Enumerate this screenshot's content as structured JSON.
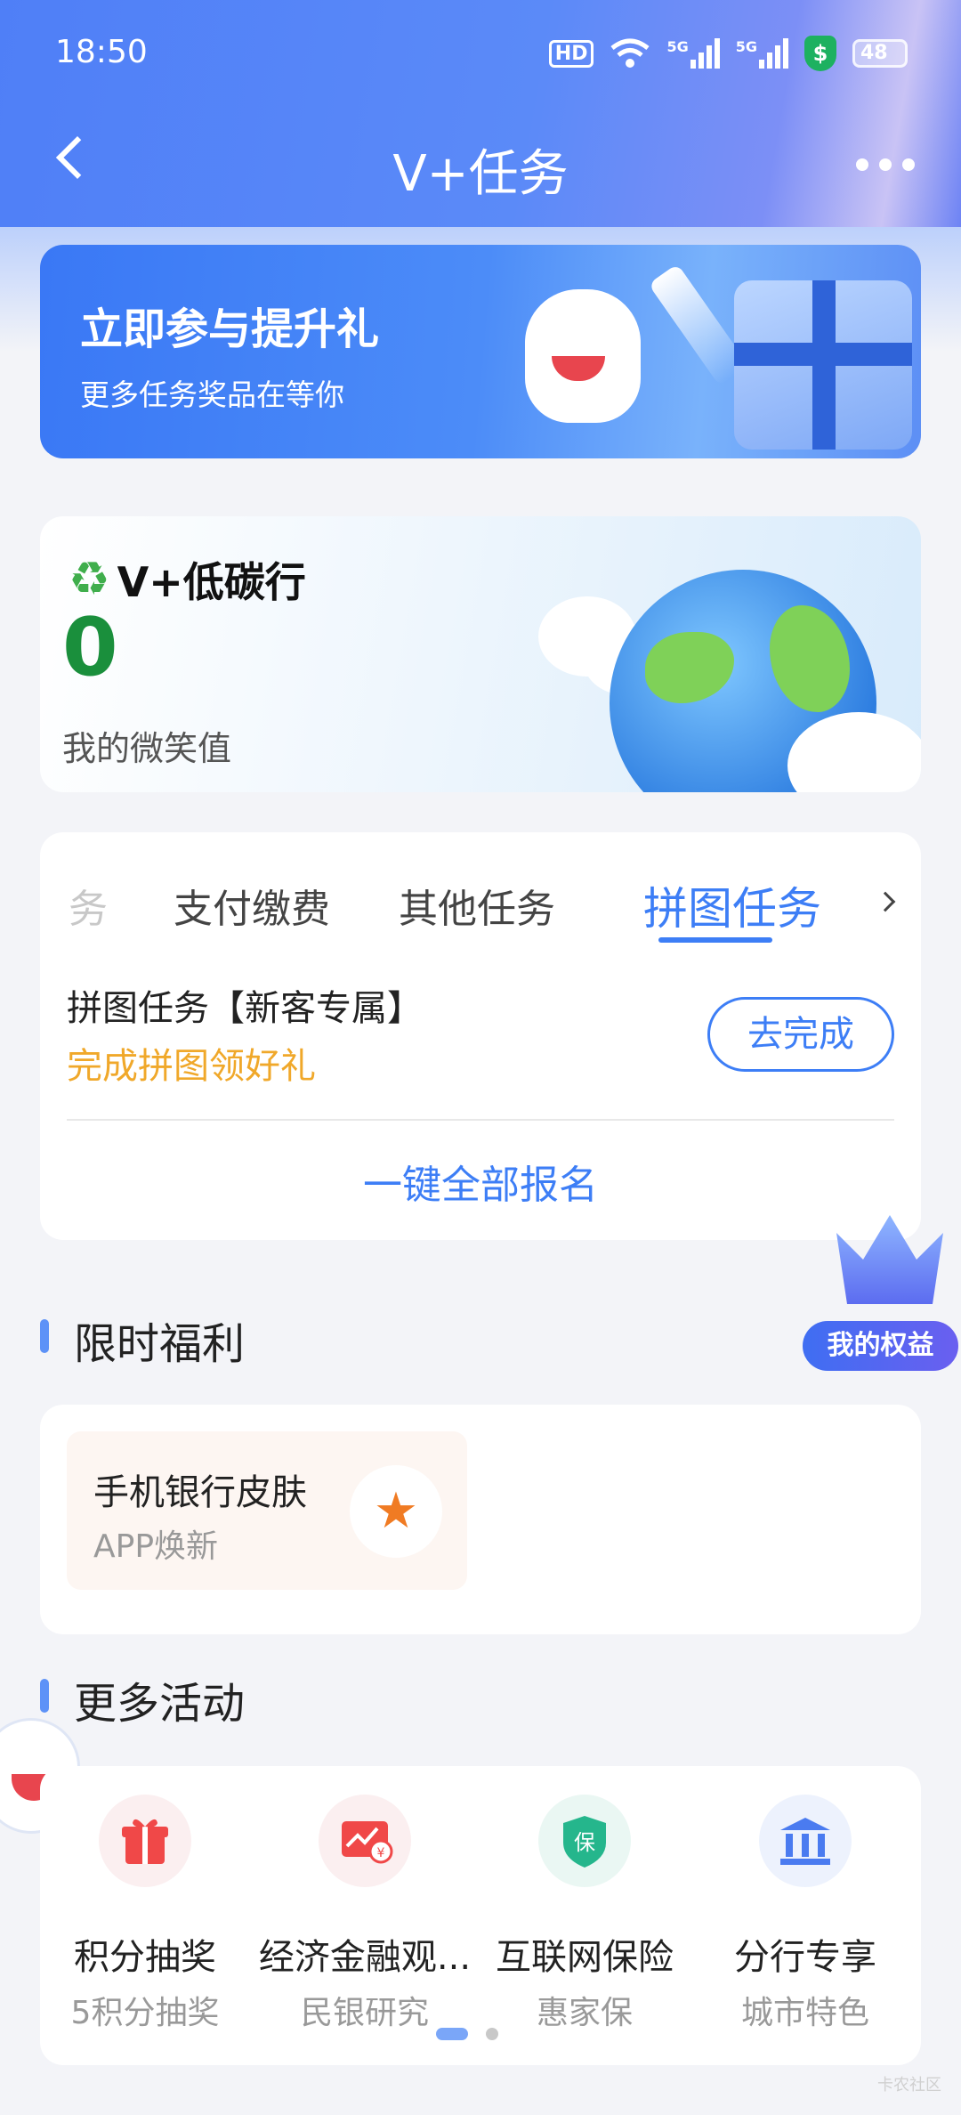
{
  "status_bar": {
    "time": "18:50",
    "hd": "HD",
    "net1": "5G",
    "net2": "5G",
    "security": "$",
    "battery": "48"
  },
  "header": {
    "title": "V+任务"
  },
  "banner": {
    "title": "立即参与提升礼",
    "subtitle": "更多任务奖品在等你"
  },
  "carbon": {
    "name": "V+低碳行",
    "value": "0",
    "label": "我的微笑值"
  },
  "task_card": {
    "tabs": [
      {
        "label": "务",
        "state": "faded"
      },
      {
        "label": "支付缴费",
        "state": "normal"
      },
      {
        "label": "其他任务",
        "state": "normal"
      },
      {
        "label": "拼图任务",
        "state": "active"
      }
    ],
    "task_name": "拼图任务【新客专属】",
    "task_desc": "完成拼图领好礼",
    "go_button": "去完成",
    "enroll_all": "一键全部报名"
  },
  "floating": {
    "rights_label": "我的权益"
  },
  "welfare": {
    "title": "限时福利",
    "item": {
      "title": "手机银行皮肤",
      "subtitle": "APP焕新",
      "icon": "magic-wand-icon"
    }
  },
  "activities": {
    "title": "更多活动",
    "items": [
      {
        "title": "积分抽奖",
        "subtitle": "5积分抽奖",
        "icon": "gift-icon",
        "color": "#f04848"
      },
      {
        "title": "经济金融观...",
        "subtitle": "民银研究",
        "icon": "chart-yuan-icon",
        "color": "#f04848"
      },
      {
        "title": "互联网保险",
        "subtitle": "惠家保",
        "icon": "shield-insurance-icon",
        "icon_text": "保",
        "color": "#25b68c"
      },
      {
        "title": "分行专享",
        "subtitle": "城市特色",
        "icon": "bank-icon",
        "color": "#4a7bf0"
      }
    ]
  },
  "watermark": "卡农社区"
}
